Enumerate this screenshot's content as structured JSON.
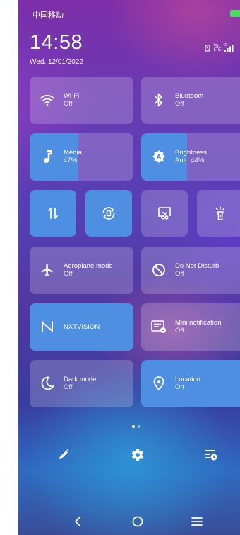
{
  "status_bar": {
    "carrier": "中国移动",
    "battery_color": "#4cd964"
  },
  "header": {
    "time": "14:58",
    "date": "Wed, 12/01/2022"
  },
  "signal": {
    "volte_top": "Vo",
    "volte_bottom": "LTE",
    "network": "4G"
  },
  "tiles": {
    "wifi": {
      "title": "Wi-Fi",
      "state": "Off"
    },
    "bluetooth": {
      "title": "Bluetooth",
      "state": "Off"
    },
    "media": {
      "title": "Media",
      "value": "47%",
      "level_percent": 47
    },
    "brightness": {
      "title": "Brightness",
      "value": "Auto 44%",
      "level_percent": 44
    },
    "aeroplane": {
      "title": "Aeroplane mode",
      "state": "Off"
    },
    "dnd": {
      "title": "Do Not Disturb",
      "state": "Off"
    },
    "nxtvision": {
      "title": "NXTVISION"
    },
    "mini_notification": {
      "title": "Mini notification",
      "state": "Off"
    },
    "dark_mode": {
      "title": "Dark mode",
      "state": "Off"
    },
    "location": {
      "title": "Location",
      "state": "On"
    }
  },
  "small_tiles": [
    {
      "icon": "data-transfer-icon",
      "state": "on"
    },
    {
      "icon": "auto-rotate-icon",
      "state": "on"
    },
    {
      "icon": "screenshot-icon",
      "state": "off"
    },
    {
      "icon": "flashlight-icon",
      "state": "off"
    }
  ],
  "pagination": {
    "pages": 2,
    "current": 1
  },
  "colors": {
    "active_tile": "#4f8fe2",
    "inactive_tile": "rgba(255,255,255,0.2)"
  }
}
